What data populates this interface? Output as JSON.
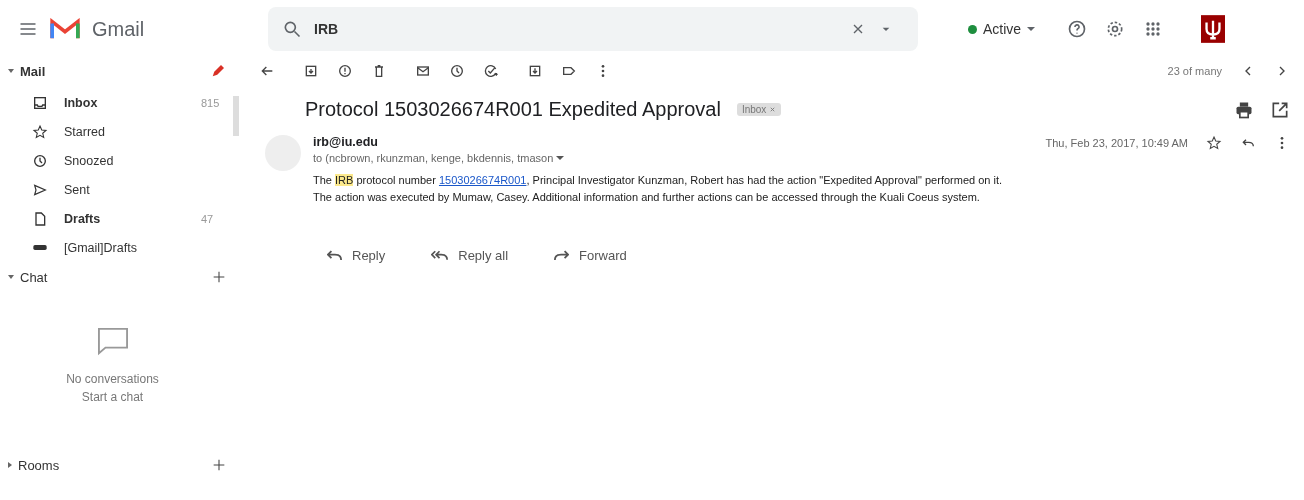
{
  "header": {
    "app_name": "Gmail",
    "search": {
      "value": "IRB"
    },
    "status": {
      "label": "Active",
      "color": "#1e8e3e"
    }
  },
  "sidebar": {
    "mail_section": {
      "title": "Mail",
      "expanded": true
    },
    "items": [
      {
        "label": "Inbox",
        "count": "815",
        "unread": true,
        "kind": "inbox"
      },
      {
        "label": "Starred",
        "unread": false,
        "kind": "starred"
      },
      {
        "label": "Snoozed",
        "unread": false,
        "kind": "snoozed"
      },
      {
        "label": "Sent",
        "unread": false,
        "kind": "sent"
      },
      {
        "label": "Drafts",
        "count": "47",
        "unread": true,
        "kind": "drafts"
      },
      {
        "label": "[Gmail]Drafts",
        "unread": false,
        "kind": "label"
      }
    ],
    "chat_section": {
      "title": "Chat",
      "expanded": true,
      "empty_title": "No conversations",
      "empty_link": "Start a chat"
    },
    "rooms_section": {
      "title": "Rooms",
      "expanded": false
    }
  },
  "toolbar": {
    "pager": "23 of many"
  },
  "email": {
    "subject": "Protocol 1503026674R001 Expedited Approval",
    "label_chip": "Inbox",
    "sender": "irb@iu.edu",
    "recipients": "to (ncbrown, rkunzman, kenge, bkdennis, tmason",
    "date": "Thu, Feb 23, 2017, 10:49 AM",
    "line_1": {
      "before": "The ",
      "highlight": "IRB",
      "middle": " protocol number ",
      "link": "1503026674R001",
      "after": ", Principal Investigator Kunzman, Robert has had the action \"Expedited Approval\" performed on it."
    },
    "line_2": "The action was executed by Mumaw, Casey. Additional information and further actions can be accessed through the Kuali Coeus system."
  },
  "actions": [
    {
      "label": "Reply",
      "kind": "reply"
    },
    {
      "label": "Reply all",
      "kind": "reply_all"
    },
    {
      "label": "Forward",
      "kind": "forward"
    }
  ]
}
